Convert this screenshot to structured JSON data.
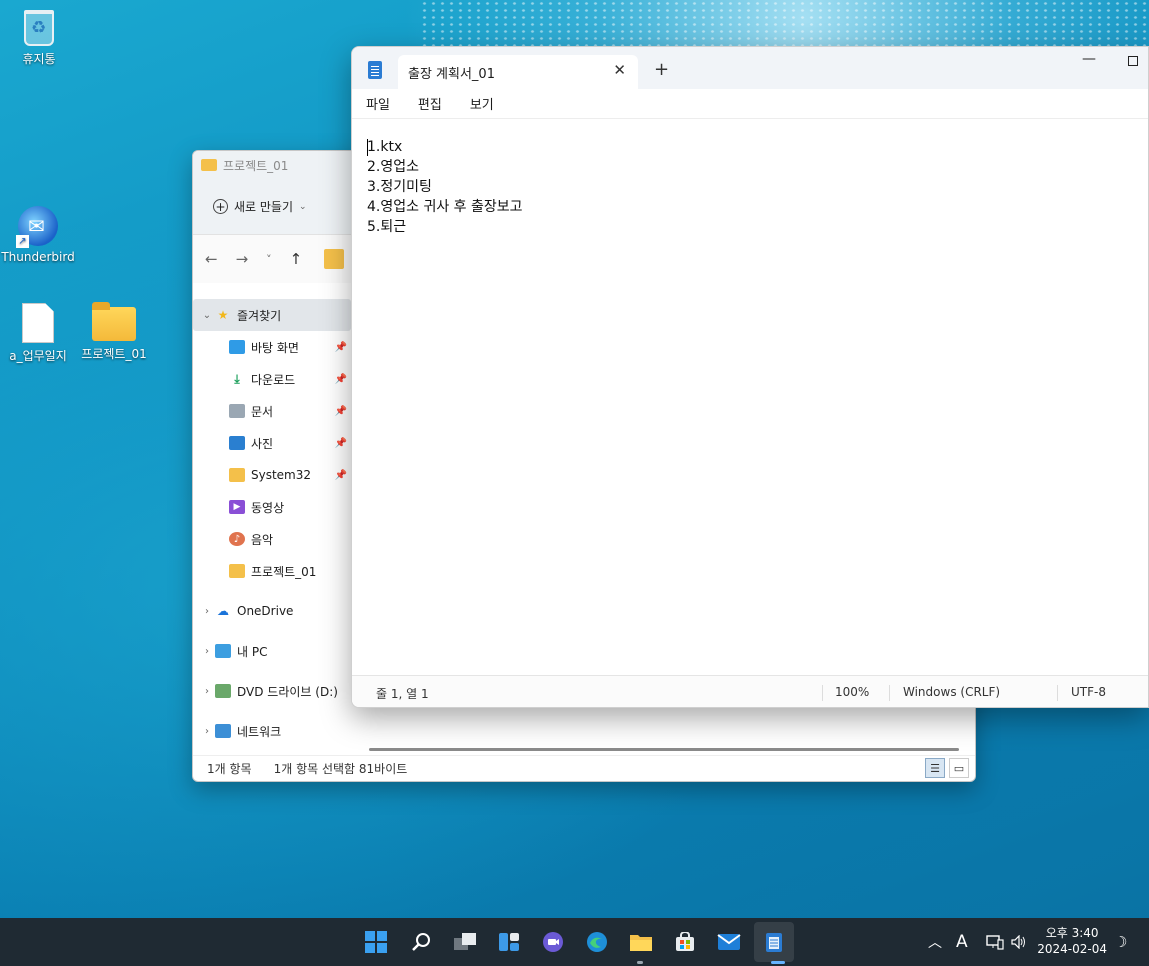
{
  "desktop": {
    "icons": [
      {
        "label": "휴지통"
      },
      {
        "label": "Thunderbird"
      },
      {
        "label": "a_업무일지"
      },
      {
        "label": "프로젝트_01"
      }
    ]
  },
  "explorer": {
    "title": "프로젝트_01",
    "new_button": "새로 만들기",
    "nav": {
      "back": "←",
      "forward": "→",
      "dropdown": "˅",
      "up": "↑"
    },
    "sidebar": {
      "favorites_label": "즐겨찾기",
      "items": [
        {
          "label": "바탕 화면"
        },
        {
          "label": "다운로드"
        },
        {
          "label": "문서"
        },
        {
          "label": "사진"
        },
        {
          "label": "System32"
        },
        {
          "label": "동영상"
        },
        {
          "label": "음악"
        },
        {
          "label": "프로젝트_01"
        }
      ],
      "onedrive": "OneDrive",
      "this_pc": "내 PC",
      "dvd": "DVD 드라이브 (D:)",
      "network": "네트워크"
    },
    "status": {
      "count": "1개 항목",
      "selection": "1개 항목 선택함 81바이트"
    }
  },
  "notepad": {
    "tab_title": "출장 계획서_01",
    "menu": {
      "file": "파일",
      "edit": "편집",
      "view": "보기"
    },
    "content": [
      "1.ktx",
      "2.영업소",
      "3.정기미팅",
      "4.영업소 귀사 후 출장보고",
      "5.퇴근"
    ],
    "status": {
      "position": "줄 1, 열 1",
      "zoom": "100%",
      "line_ending": "Windows (CRLF)",
      "encoding": "UTF-8"
    }
  },
  "taskbar": {
    "tray": {
      "ime": "A"
    },
    "clock": {
      "time": "오후 3:40",
      "date": "2024-02-04"
    }
  },
  "colors": {
    "accent": "#2b7cd3",
    "taskbar": "#1f2a33",
    "folder": "#f4c04a"
  }
}
